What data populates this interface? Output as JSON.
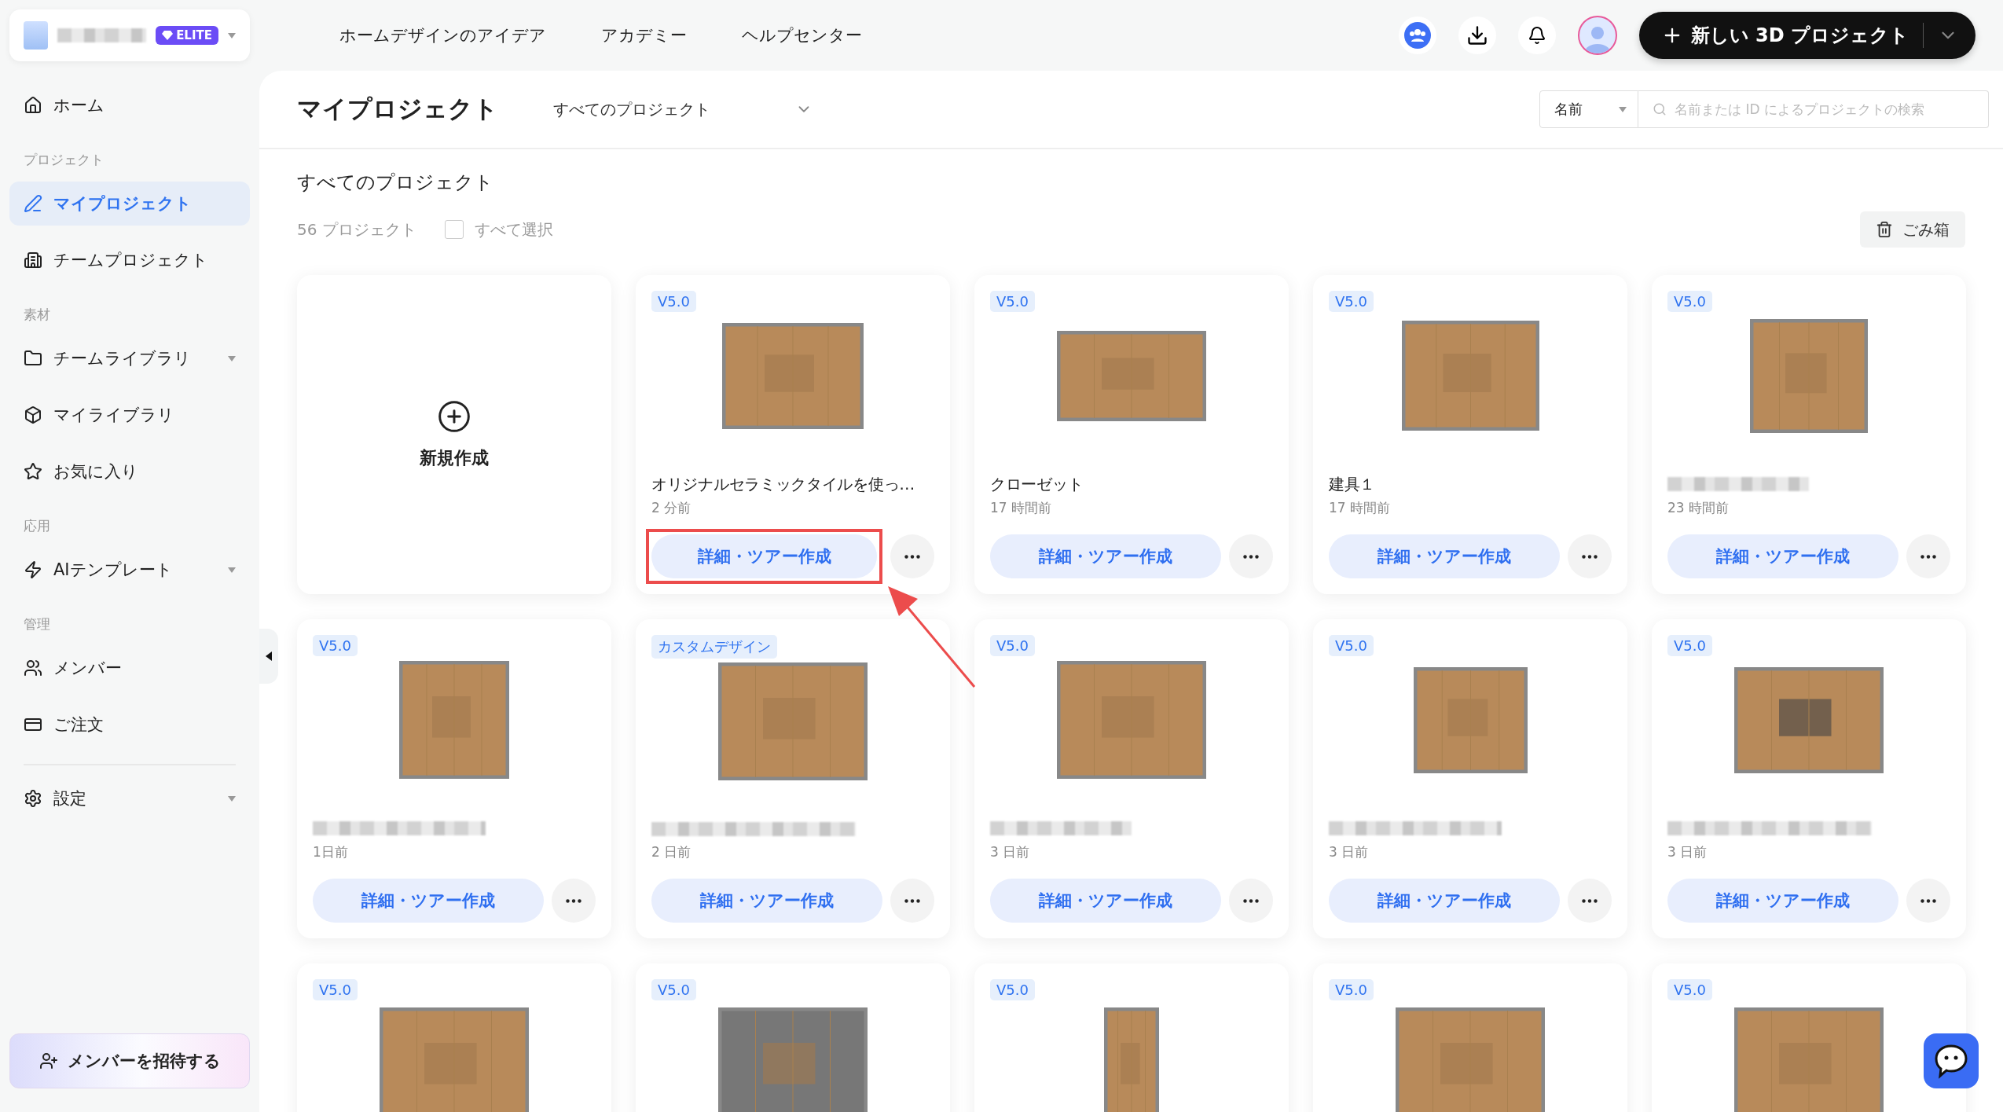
{
  "account": {
    "badge": "ELITE"
  },
  "nav": [
    "ホームデザインのアイデア",
    "アカデミー",
    "ヘルプセンター"
  ],
  "new_project_button": "新しい 3D プロジェクト",
  "sidebar": {
    "sections": [
      {
        "items": [
          {
            "label": "ホーム",
            "selected": false,
            "has_submenu": false
          }
        ]
      },
      {
        "label": "プロジェクト",
        "items": [
          {
            "label": "マイプロジェクト",
            "selected": true,
            "has_submenu": false
          },
          {
            "label": "チームプロジェクト",
            "selected": false,
            "has_submenu": false
          }
        ]
      },
      {
        "label": "素材",
        "items": [
          {
            "label": "チームライブラリ",
            "selected": false,
            "has_submenu": true
          },
          {
            "label": "マイライブラリ",
            "selected": false,
            "has_submenu": false
          },
          {
            "label": "お気に入り",
            "selected": false,
            "has_submenu": false
          }
        ]
      },
      {
        "label": "応用",
        "items": [
          {
            "label": "AIテンプレート",
            "selected": false,
            "has_submenu": true
          }
        ]
      },
      {
        "label": "管理",
        "items": [
          {
            "label": "メンバー",
            "selected": false,
            "has_submenu": false
          },
          {
            "label": "ご注文",
            "selected": false,
            "has_submenu": false
          }
        ]
      },
      {
        "divider": true,
        "items": [
          {
            "label": "設定",
            "selected": false,
            "has_submenu": true
          }
        ]
      }
    ],
    "invite_button": "メンバーを招待する"
  },
  "main": {
    "title": "マイプロジェクト",
    "filter": "すべてのプロジェクト",
    "sort": "名前",
    "search": {
      "placeholder": "名前または ID によるプロジェクトの検索"
    },
    "section_title": "すべてのプロジェクト",
    "count": "56 プロジェクト",
    "select_all": {
      "label": "すべて選択",
      "checked": false
    },
    "trash_button": "ごみ箱",
    "new_card_label": "新規作成",
    "cards": [
      {
        "badge": "V5.0",
        "title": "オリジナルセラミックタイルを使っ…",
        "title_blurred": false,
        "time": "2 分前",
        "button": "詳細・ツアー作成",
        "highlighted": true
      },
      {
        "badge": "V5.0",
        "title": "クローゼット",
        "title_blurred": false,
        "time": "17 時間前",
        "button": "詳細・ツアー作成",
        "highlighted": false
      },
      {
        "badge": "V5.0",
        "title": "建具１",
        "title_blurred": false,
        "time": "17 時間前",
        "button": "詳細・ツアー作成",
        "highlighted": false
      },
      {
        "badge": "V5.0",
        "title_blurred": true,
        "time": "23 時間前",
        "button": "詳細・ツアー作成",
        "highlighted": false
      },
      {
        "badge": "V5.0",
        "title_blurred": true,
        "time": "1日前",
        "button": "詳細・ツアー作成",
        "highlighted": false
      },
      {
        "badge": "カスタムデザイン",
        "title_blurred": true,
        "time": "2 日前",
        "button": "詳細・ツアー作成",
        "highlighted": false
      },
      {
        "badge": "V5.0",
        "title_blurred": true,
        "time": "3 日前",
        "button": "詳細・ツアー作成",
        "highlighted": false
      },
      {
        "badge": "V5.0",
        "title_blurred": true,
        "time": "3 日前",
        "button": "詳細・ツアー作成",
        "highlighted": false
      },
      {
        "badge": "V5.0",
        "title_blurred": true,
        "time": "3 日前",
        "button": "詳細・ツアー作成",
        "highlighted": false
      },
      {
        "badge": "V5.0"
      },
      {
        "badge": "V5.0"
      },
      {
        "badge": "V5.0"
      },
      {
        "badge": "V5.0"
      },
      {
        "badge": "V5.0"
      }
    ]
  }
}
